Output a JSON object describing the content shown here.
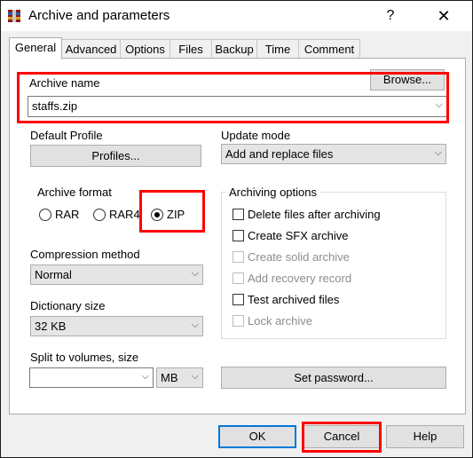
{
  "window": {
    "title": "Archive and parameters",
    "help": "?",
    "close": "✕"
  },
  "tabs": [
    {
      "label": "General"
    },
    {
      "label": "Advanced"
    },
    {
      "label": "Options"
    },
    {
      "label": "Files"
    },
    {
      "label": "Backup"
    },
    {
      "label": "Time"
    },
    {
      "label": "Comment"
    }
  ],
  "archive_name": {
    "label": "Archive name",
    "value": "staffs.zip",
    "browse": "Browse..."
  },
  "profile": {
    "label": "Default Profile",
    "button": "Profiles..."
  },
  "update_mode": {
    "label": "Update mode",
    "value": "Add and replace files"
  },
  "archive_format": {
    "label": "Archive format",
    "options": [
      "RAR",
      "RAR4",
      "ZIP"
    ],
    "selected": "ZIP"
  },
  "compression": {
    "label": "Compression method",
    "value": "Normal"
  },
  "dictionary": {
    "label": "Dictionary size",
    "value": "32 KB"
  },
  "split": {
    "label": "Split to volumes, size",
    "value": "",
    "unit": "MB"
  },
  "archiving_options": {
    "label": "Archiving options",
    "items": [
      {
        "label": "Delete files after archiving",
        "enabled": true
      },
      {
        "label": "Create SFX archive",
        "enabled": true
      },
      {
        "label": "Create solid archive",
        "enabled": false
      },
      {
        "label": "Add recovery record",
        "enabled": false
      },
      {
        "label": "Test archived files",
        "enabled": true
      },
      {
        "label": "Lock archive",
        "enabled": false
      }
    ]
  },
  "set_password": "Set password...",
  "buttons": {
    "ok": "OK",
    "cancel": "Cancel",
    "help": "Help"
  },
  "colors": {
    "highlight": "#ff0000",
    "default_button_border": "#0078d7"
  }
}
